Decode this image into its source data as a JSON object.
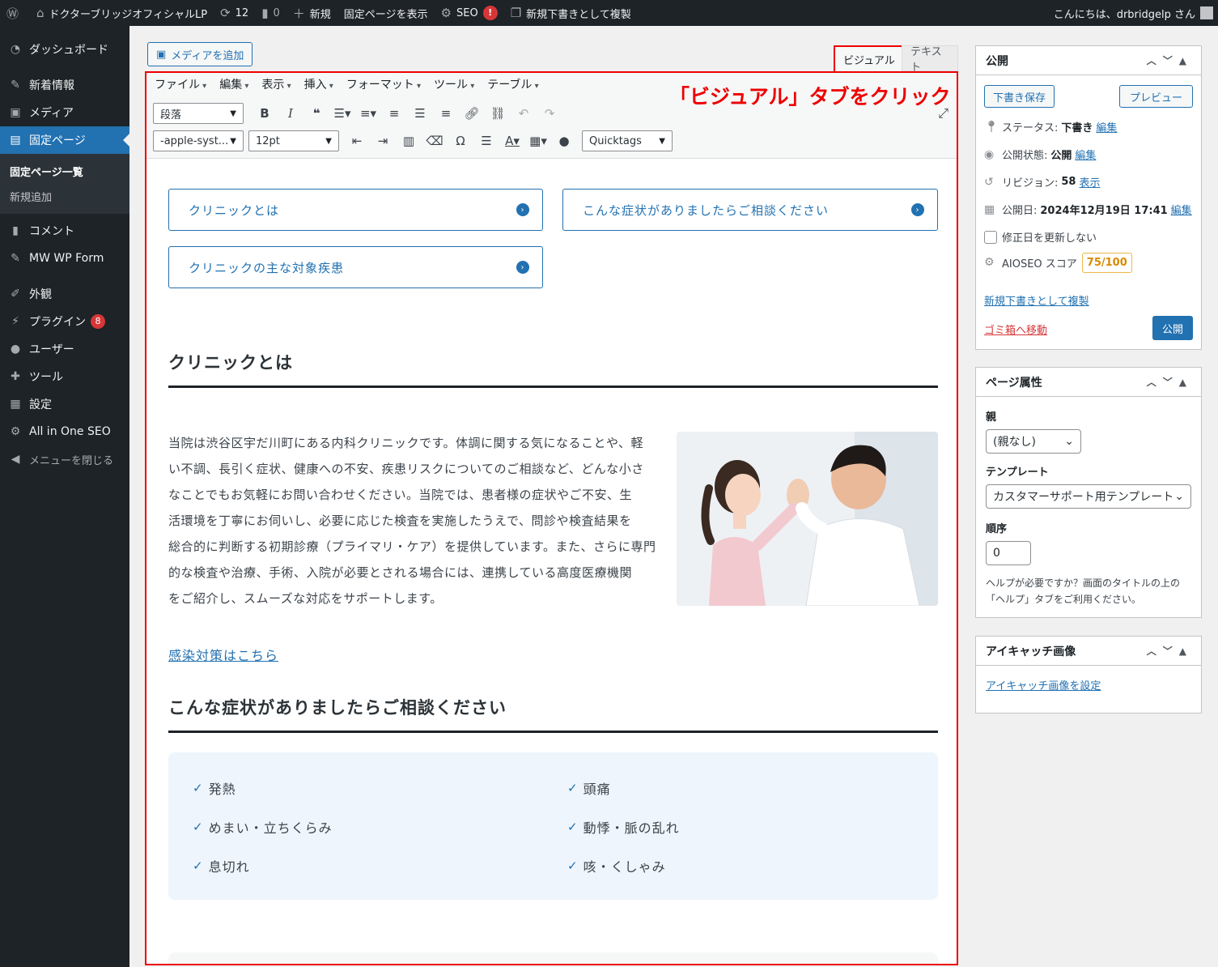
{
  "adminbar": {
    "site_name": "ドクターブリッジオフィシャルLP",
    "updates_count": "12",
    "comments_count": "0",
    "new_label": "新規",
    "view_page": "固定ページを表示",
    "seo_label": "SEO",
    "seo_alert": "!",
    "duplicate_label": "新規下書きとして複製",
    "greeting": "こんにちは、drbridgelp さん"
  },
  "menu": {
    "dashboard": "ダッシュボード",
    "posts": "新着情報",
    "media": "メディア",
    "pages": "固定ページ",
    "pages_all": "固定ページ一覧",
    "pages_new": "新規追加",
    "comments": "コメント",
    "mwwpform": "MW WP Form",
    "appearance": "外観",
    "plugins": "プラグイン",
    "plugins_badge": "8",
    "users": "ユーザー",
    "tools": "ツール",
    "settings": "設定",
    "aioseo": "All in One SEO",
    "collapse": "メニューを閉じる"
  },
  "editor": {
    "add_media": "メディアを追加",
    "tab_visual": "ビジュアル",
    "tab_text": "テキスト",
    "annotation": "「ビジュアル」タブをクリック",
    "menubar": [
      "ファイル",
      "編集",
      "表示",
      "挿入",
      "フォーマット",
      "ツール",
      "テーブル"
    ],
    "format_select": "段落",
    "font_family": "-apple-syst...",
    "font_size": "12pt",
    "quicktags": "Quicktags"
  },
  "content": {
    "links": [
      "クリニックとは",
      "こんな症状がありましたらご相談ください",
      "クリニックの主な対象疾患"
    ],
    "heading1": "クリニックとは",
    "paragraph_lines": [
      "当院は渋谷区宇だ川町にある内科クリニックです。体調に関する気になることや、軽",
      "い不調、長引く症状、健康への不安、疾患リスクについてのご相談など、どんな小さ",
      "なことでもお気軽にお問い合わせください。当院では、患者様の症状やご不安、生",
      "活環境を丁寧にお伺いし、必要に応じた検査を実施したうえで、問診や検査結果を",
      "総合的に判断する初期診療（プライマリ・ケア）を提供しています。また、さらに専門",
      "的な検査や治療、手術、入院が必要とされる場合には、連携している高度医療機関",
      "をご紹介し、スムーズな対応をサポートします。"
    ],
    "infection_link": "感染対策はこちら",
    "heading2": "こんな症状がありましたらご相談ください",
    "symptoms": [
      "発熱",
      "頭痛",
      "めまい・立ちくらみ",
      "動悸・脈の乱れ",
      "息切れ",
      "咳・くしゃみ"
    ]
  },
  "publish": {
    "title": "公開",
    "save_draft": "下書き保存",
    "preview": "プレビュー",
    "status_label": "ステータス:",
    "status_value": "下書き",
    "visibility_label": "公開状態:",
    "visibility_value": "公開",
    "revisions_label": "リビジョン:",
    "revisions_value": "58",
    "revisions_link": "表示",
    "date_label": "公開日:",
    "date_value": "2024年12月19日 17:41",
    "edit": "編集",
    "no_update_date": "修正日を更新しない",
    "aioseo_label": "AIOSEO スコア",
    "aioseo_score": "75/100",
    "duplicate": "新規下書きとして複製",
    "trash": "ゴミ箱へ移動",
    "publish_btn": "公開"
  },
  "attributes": {
    "title": "ページ属性",
    "parent_label": "親",
    "parent_value": "(親なし)",
    "template_label": "テンプレート",
    "template_value": "カスタマーサポート用テンプレート",
    "order_label": "順序",
    "order_value": "0",
    "help_text": "ヘルプが必要ですか？画面のタイトルの上の「ヘルプ」タブをご利用ください。"
  },
  "featured": {
    "title": "アイキャッチ画像",
    "set_link": "アイキャッチ画像を設定"
  },
  "colors": {
    "accent": "#2271b1",
    "annotation": "#ee0000",
    "sidebar": "#1d2327"
  }
}
